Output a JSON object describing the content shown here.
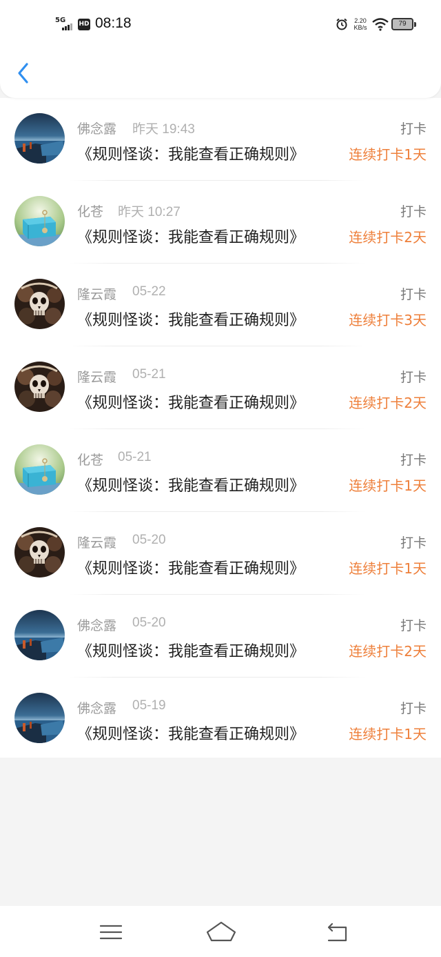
{
  "status_bar": {
    "network": "5G",
    "hd": "HD",
    "time": "08:18",
    "speed_value": "2.20",
    "speed_unit": "KB/s",
    "battery": "79"
  },
  "list": {
    "items": [
      {
        "name": "佛念露",
        "time": "昨天 19:43",
        "title": "《规则怪谈：我能查看正确规则》",
        "type": "打卡",
        "streak": "连续打卡1天",
        "avatar": "sea-avatar"
      },
      {
        "name": "化苍",
        "time": "昨天 10:27",
        "title": "《规则怪谈：我能查看正确规则》",
        "type": "打卡",
        "streak": "连续打卡2天",
        "avatar": "giftbox-avatar"
      },
      {
        "name": "隆云霞",
        "time": "05-22",
        "title": "《规则怪谈：我能查看正确规则》",
        "type": "打卡",
        "streak": "连续打卡3天",
        "avatar": "skull-avatar"
      },
      {
        "name": "隆云霞",
        "time": "05-21",
        "title": "《规则怪谈：我能查看正确规则》",
        "type": "打卡",
        "streak": "连续打卡2天",
        "avatar": "skull-avatar"
      },
      {
        "name": "化苍",
        "time": "05-21",
        "title": "《规则怪谈：我能查看正确规则》",
        "type": "打卡",
        "streak": "连续打卡1天",
        "avatar": "giftbox-avatar"
      },
      {
        "name": "隆云霞",
        "time": "05-20",
        "title": "《规则怪谈：我能查看正确规则》",
        "type": "打卡",
        "streak": "连续打卡1天",
        "avatar": "skull-avatar"
      },
      {
        "name": "佛念露",
        "time": "05-20",
        "title": "《规则怪谈：我能查看正确规则》",
        "type": "打卡",
        "streak": "连续打卡2天",
        "avatar": "sea-avatar"
      },
      {
        "name": "佛念露",
        "time": "05-19",
        "title": "《规则怪谈：我能查看正确规则》",
        "type": "打卡",
        "streak": "连续打卡1天",
        "avatar": "sea-avatar"
      }
    ]
  },
  "colors": {
    "accent_blue": "#2f8ff0",
    "streak_orange": "#ee7f3a",
    "title_text": "#222222",
    "meta_text": "#9a9a9a",
    "background": "#f4f4f4"
  }
}
